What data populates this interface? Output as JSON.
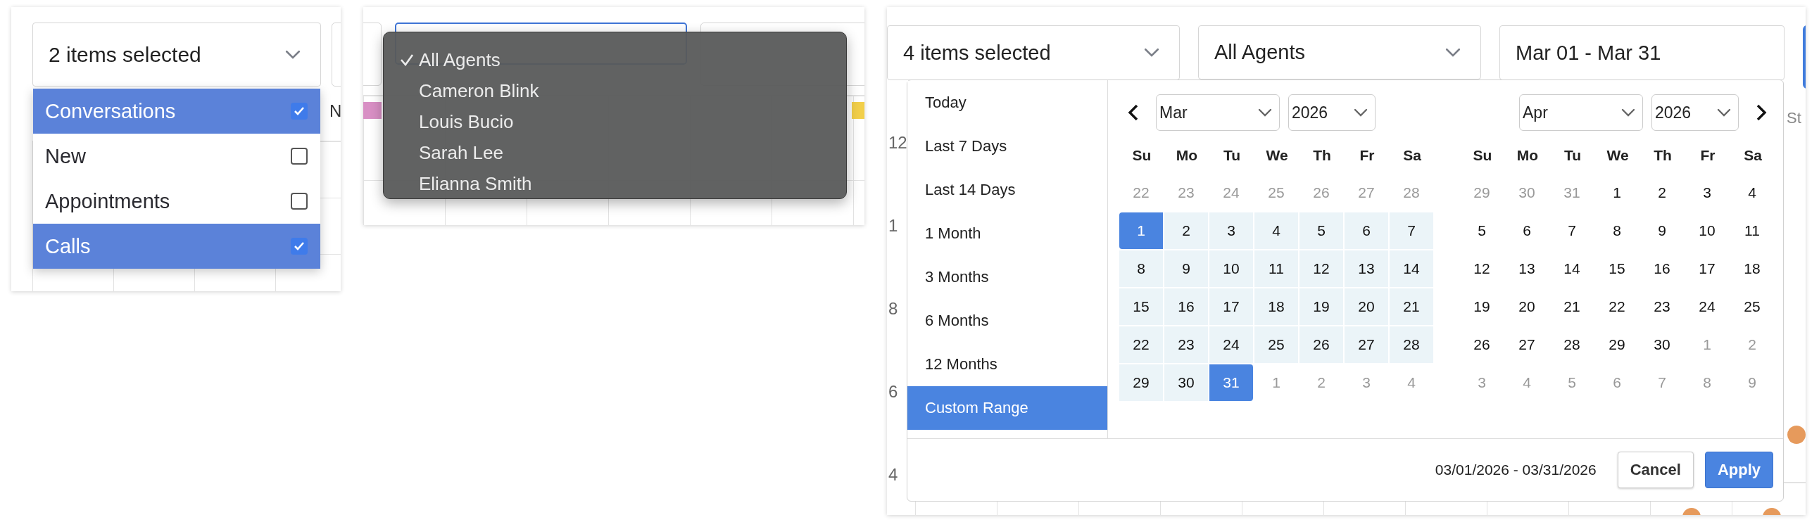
{
  "type_filter_panel": {
    "trigger": "2 items selected",
    "header_label": "N",
    "options": [
      {
        "label": "Conversations",
        "checked": true
      },
      {
        "label": "New",
        "checked": false
      },
      {
        "label": "Appointments",
        "checked": false
      },
      {
        "label": "Calls",
        "checked": true
      }
    ]
  },
  "agent_filter_panel": {
    "options": [
      {
        "label": "All Agents",
        "selected": true
      },
      {
        "label": "Cameron Blink",
        "selected": false
      },
      {
        "label": "Louis Bucio",
        "selected": false
      },
      {
        "label": "Sarah Lee",
        "selected": false
      },
      {
        "label": "Elianna Smith",
        "selected": false
      }
    ]
  },
  "report_panel": {
    "type_trigger": "4 items selected",
    "agent_trigger": "All Agents",
    "date_trigger": "Mar 01 - Mar 31",
    "axis_labels": [
      "12",
      "1",
      "8",
      "6",
      "4"
    ],
    "edge_label": "St",
    "date_picker": {
      "ranges": [
        {
          "label": "Today",
          "selected": false
        },
        {
          "label": "Last 7 Days",
          "selected": false
        },
        {
          "label": "Last 14 Days",
          "selected": false
        },
        {
          "label": "1 Month",
          "selected": false
        },
        {
          "label": "3 Months",
          "selected": false
        },
        {
          "label": "6 Months",
          "selected": false
        },
        {
          "label": "12 Months",
          "selected": false
        },
        {
          "label": "Custom Range",
          "selected": true
        }
      ],
      "calendars": [
        {
          "prev_arrow": true,
          "next_arrow": false,
          "month": "Mar",
          "year": "2026",
          "weekdays": [
            "Su",
            "Mo",
            "Tu",
            "We",
            "Th",
            "Fr",
            "Sa"
          ],
          "weeks": [
            [
              {
                "day": "22",
                "kind": "off"
              },
              {
                "day": "23",
                "kind": "off"
              },
              {
                "day": "24",
                "kind": "off"
              },
              {
                "day": "25",
                "kind": "off"
              },
              {
                "day": "26",
                "kind": "off"
              },
              {
                "day": "27",
                "kind": "off"
              },
              {
                "day": "28",
                "kind": "off"
              }
            ],
            [
              {
                "day": "1",
                "kind": "start"
              },
              {
                "day": "2",
                "kind": "range"
              },
              {
                "day": "3",
                "kind": "range"
              },
              {
                "day": "4",
                "kind": "range"
              },
              {
                "day": "5",
                "kind": "range"
              },
              {
                "day": "6",
                "kind": "range"
              },
              {
                "day": "7",
                "kind": "range"
              }
            ],
            [
              {
                "day": "8",
                "kind": "range"
              },
              {
                "day": "9",
                "kind": "range"
              },
              {
                "day": "10",
                "kind": "range"
              },
              {
                "day": "11",
                "kind": "range"
              },
              {
                "day": "12",
                "kind": "range"
              },
              {
                "day": "13",
                "kind": "range"
              },
              {
                "day": "14",
                "kind": "range"
              }
            ],
            [
              {
                "day": "15",
                "kind": "range"
              },
              {
                "day": "16",
                "kind": "range"
              },
              {
                "day": "17",
                "kind": "range"
              },
              {
                "day": "18",
                "kind": "range"
              },
              {
                "day": "19",
                "kind": "range"
              },
              {
                "day": "20",
                "kind": "range"
              },
              {
                "day": "21",
                "kind": "range"
              }
            ],
            [
              {
                "day": "22",
                "kind": "range"
              },
              {
                "day": "23",
                "kind": "range"
              },
              {
                "day": "24",
                "kind": "range"
              },
              {
                "day": "25",
                "kind": "range"
              },
              {
                "day": "26",
                "kind": "range"
              },
              {
                "day": "27",
                "kind": "range"
              },
              {
                "day": "28",
                "kind": "range"
              }
            ],
            [
              {
                "day": "29",
                "kind": "range"
              },
              {
                "day": "30",
                "kind": "range"
              },
              {
                "day": "31",
                "kind": "end"
              },
              {
                "day": "1",
                "kind": "off"
              },
              {
                "day": "2",
                "kind": "off"
              },
              {
                "day": "3",
                "kind": "off"
              },
              {
                "day": "4",
                "kind": "off"
              }
            ]
          ]
        },
        {
          "prev_arrow": false,
          "next_arrow": true,
          "month": "Apr",
          "year": "2026",
          "weekdays": [
            "Su",
            "Mo",
            "Tu",
            "We",
            "Th",
            "Fr",
            "Sa"
          ],
          "weeks": [
            [
              {
                "day": "29",
                "kind": "off"
              },
              {
                "day": "30",
                "kind": "off"
              },
              {
                "day": "31",
                "kind": "off"
              },
              {
                "day": "1",
                "kind": "plain"
              },
              {
                "day": "2",
                "kind": "plain"
              },
              {
                "day": "3",
                "kind": "plain"
              },
              {
                "day": "4",
                "kind": "plain"
              }
            ],
            [
              {
                "day": "5",
                "kind": "plain"
              },
              {
                "day": "6",
                "kind": "plain"
              },
              {
                "day": "7",
                "kind": "plain"
              },
              {
                "day": "8",
                "kind": "plain"
              },
              {
                "day": "9",
                "kind": "plain"
              },
              {
                "day": "10",
                "kind": "plain"
              },
              {
                "day": "11",
                "kind": "plain"
              }
            ],
            [
              {
                "day": "12",
                "kind": "plain"
              },
              {
                "day": "13",
                "kind": "plain"
              },
              {
                "day": "14",
                "kind": "plain"
              },
              {
                "day": "15",
                "kind": "plain"
              },
              {
                "day": "16",
                "kind": "plain"
              },
              {
                "day": "17",
                "kind": "plain"
              },
              {
                "day": "18",
                "kind": "plain"
              }
            ],
            [
              {
                "day": "19",
                "kind": "plain"
              },
              {
                "day": "20",
                "kind": "plain"
              },
              {
                "day": "21",
                "kind": "plain"
              },
              {
                "day": "22",
                "kind": "plain"
              },
              {
                "day": "23",
                "kind": "plain"
              },
              {
                "day": "24",
                "kind": "plain"
              },
              {
                "day": "25",
                "kind": "plain"
              }
            ],
            [
              {
                "day": "26",
                "kind": "plain"
              },
              {
                "day": "27",
                "kind": "plain"
              },
              {
                "day": "28",
                "kind": "plain"
              },
              {
                "day": "29",
                "kind": "plain"
              },
              {
                "day": "30",
                "kind": "plain"
              },
              {
                "day": "1",
                "kind": "off"
              },
              {
                "day": "2",
                "kind": "off"
              }
            ],
            [
              {
                "day": "3",
                "kind": "off"
              },
              {
                "day": "4",
                "kind": "off"
              },
              {
                "day": "5",
                "kind": "off"
              },
              {
                "day": "6",
                "kind": "off"
              },
              {
                "day": "7",
                "kind": "off"
              },
              {
                "day": "8",
                "kind": "off"
              },
              {
                "day": "9",
                "kind": "off"
              }
            ]
          ]
        }
      ],
      "range_text": "03/01/2026 - 03/31/2026",
      "buttons": [
        {
          "label": "Cancel",
          "kind": "secondary"
        },
        {
          "label": "Apply",
          "kind": "primary"
        }
      ]
    }
  }
}
